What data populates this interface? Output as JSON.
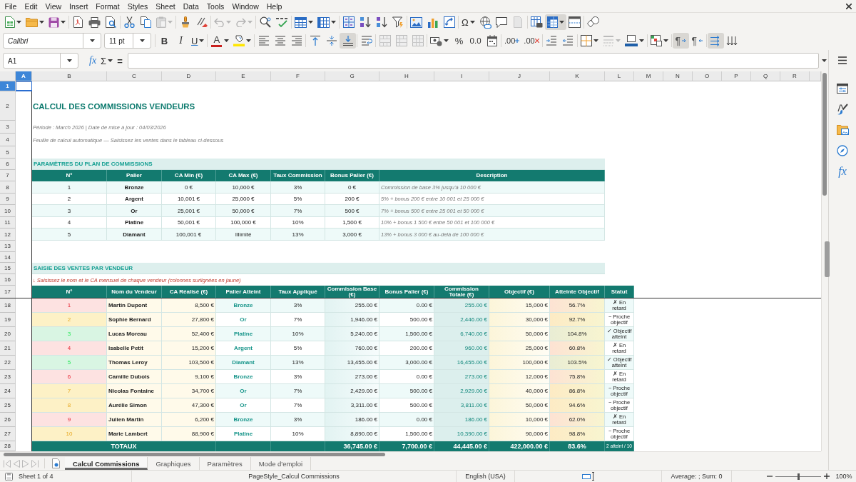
{
  "menu_bar": {
    "items": [
      "File",
      "Edit",
      "View",
      "Insert",
      "Format",
      "Styles",
      "Sheet",
      "Data",
      "Tools",
      "Window",
      "Help"
    ]
  },
  "standard_toolbar": {
    "special_character": "Ω",
    "freeze_rows_and_columns": {
      "pressed": true
    }
  },
  "formatting_toolbar": {
    "font_name": "Calibri",
    "font_size": "11 pt",
    "bold": "B",
    "italic": "I",
    "underline": "U",
    "font_color": "A",
    "align_bottom": {
      "pressed": true
    },
    "percent": "%",
    "number_format": "0.0",
    "add_decimal": ".00",
    "delete_decimal": ".00",
    "paragraph_left_to_right": {
      "glyph": "¶",
      "pressed": true
    },
    "paragraph_right_to_left": {
      "glyph": "¶",
      "pressed": false
    },
    "text_direction_left_to_right": {
      "pressed": true
    }
  },
  "formula_bar": {
    "name_box": "A1",
    "function_wizard": "fx",
    "sum": "Σ",
    "formula": "="
  },
  "sheet": {
    "column_headers": [
      {
        "label": "A",
        "selected": true
      },
      {
        "label": "B",
        "selected": false
      },
      {
        "label": "C",
        "selected": false
      },
      {
        "label": "D",
        "selected": false
      },
      {
        "label": "E",
        "selected": false
      },
      {
        "label": "F",
        "selected": false
      },
      {
        "label": "G",
        "selected": false
      },
      {
        "label": "H",
        "selected": false
      },
      {
        "label": "I",
        "selected": false
      },
      {
        "label": "J",
        "selected": false
      },
      {
        "label": "K",
        "selected": false
      },
      {
        "label": "L",
        "selected": false
      },
      {
        "label": "M",
        "selected": false
      },
      {
        "label": "N",
        "selected": false
      },
      {
        "label": "O",
        "selected": false
      },
      {
        "label": "P",
        "selected": false
      },
      {
        "label": "Q",
        "selected": false
      },
      {
        "label": "R",
        "selected": false
      }
    ],
    "row_headers": [
      {
        "label": "1",
        "selected": true
      },
      {
        "label": "2",
        "selected": false
      },
      {
        "label": "3",
        "selected": false
      },
      {
        "label": "4",
        "selected": false
      },
      {
        "label": "5",
        "selected": false
      },
      {
        "label": "6",
        "selected": false
      },
      {
        "label": "7",
        "selected": false
      },
      {
        "label": "8",
        "selected": false
      },
      {
        "label": "9",
        "selected": false
      },
      {
        "label": "10",
        "selected": false
      },
      {
        "label": "11",
        "selected": false
      },
      {
        "label": "12",
        "selected": false
      },
      {
        "label": "13",
        "selected": false
      },
      {
        "label": "14",
        "selected": false
      },
      {
        "label": "15",
        "selected": false
      },
      {
        "label": "16",
        "selected": false
      },
      {
        "label": "17",
        "selected": false
      },
      {
        "label": "18",
        "selected": false
      },
      {
        "label": "19",
        "selected": false
      },
      {
        "label": "20",
        "selected": false
      },
      {
        "label": "21",
        "selected": false
      },
      {
        "label": "22",
        "selected": false
      },
      {
        "label": "23",
        "selected": false
      },
      {
        "label": "24",
        "selected": false
      },
      {
        "label": "25",
        "selected": false
      },
      {
        "label": "26",
        "selected": false
      },
      {
        "label": "27",
        "selected": false
      },
      {
        "label": "28",
        "selected": false
      }
    ],
    "title": "CALCUL DES COMMISSIONS VENDEURS",
    "period": "Période : March 2026 | Date de mise à jour : 04/03/2026",
    "note": "Feuille de calcul automatique — Saisissez les ventes dans le tableau ci-dessous",
    "parameters": {
      "heading": "PARAMÈTRES DU PLAN DE COMMISSIONS",
      "columns": [
        "N°",
        "Palier",
        "CA Min (€)",
        "CA Max (€)",
        "Taux Commission",
        "Bonus Palier (€)",
        "Description"
      ],
      "rows": [
        {
          "number": "1",
          "tier": "Bronze",
          "ca_min": "0 €",
          "ca_max": "10,000 €",
          "rate": "3%",
          "bonus": "0 €",
          "description": "Commission de base 3% jusqu'à 10 000 €"
        },
        {
          "number": "2",
          "tier": "Argent",
          "ca_min": "10,001 €",
          "ca_max": "25,000 €",
          "rate": "5%",
          "bonus": "200 €",
          "description": "5% + bonus 200 € entre 10 001 et 25 000 €"
        },
        {
          "number": "3",
          "tier": "Or",
          "ca_min": "25,001 €",
          "ca_max": "50,000 €",
          "rate": "7%",
          "bonus": "500 €",
          "description": "7% + bonus 500 € entre 25 001 et 50 000 €"
        },
        {
          "number": "4",
          "tier": "Platine",
          "ca_min": "50,001 €",
          "ca_max": "100,000 €",
          "rate": "10%",
          "bonus": "1,500 €",
          "description": "10% + bonus 1 500 € entre 50 001 et 100 000 €"
        },
        {
          "number": "5",
          "tier": "Diamant",
          "ca_min": "100,001 €",
          "ca_max": "Illimité",
          "rate": "13%",
          "bonus": "3,000 €",
          "description": "13% + bonus 3 000 € au-delà de 100 000 €"
        }
      ]
    },
    "sales": {
      "heading": "SAISIE DES VENTES PAR VENDEUR",
      "instruction": "↓ Saisissez le nom et le CA mensuel de chaque vendeur (colonnes surlignées en jaune)",
      "columns": [
        "N°",
        "Nom du Vendeur",
        "CA Réalisé (€)",
        "Palier Atteint",
        "Taux Appliqué",
        "Commission Base (€)",
        "Bonus Palier (€)",
        "Commission Totale (€)",
        "Objectif (€)",
        "Atteinte Objectif",
        "Statut"
      ],
      "rows": [
        {
          "number": "1",
          "color": "#fde2e1",
          "seller": "Martin Dupont",
          "revenue": "8,500 €",
          "tier": "Bronze",
          "rate": "3%",
          "commission_base": "255.00 €",
          "bonus": "0.00 €",
          "commission_total": "255.00 €",
          "objective": "15,000 €",
          "attainment": "56.7%",
          "status": "✗ En retard"
        },
        {
          "number": "2",
          "color": "#fdf1c6",
          "seller": "Sophie Bernard",
          "revenue": "27,800 €",
          "tier": "Or",
          "rate": "7%",
          "commission_base": "1,946.00 €",
          "bonus": "500.00 €",
          "commission_total": "2,446.00 €",
          "objective": "30,000 €",
          "attainment": "92.7%",
          "status": "~ Proche objectif"
        },
        {
          "number": "3",
          "color": "#d9f5e3",
          "seller": "Lucas Moreau",
          "revenue": "52,400 €",
          "tier": "Platine",
          "rate": "10%",
          "commission_base": "5,240.00 €",
          "bonus": "1,500.00 €",
          "commission_total": "6,740.00 €",
          "objective": "50,000 €",
          "attainment": "104.8%",
          "status": "✓ Objectif atteint"
        },
        {
          "number": "4",
          "color": "#fde2e1",
          "seller": "Isabelle Petit",
          "revenue": "15,200 €",
          "tier": "Argent",
          "rate": "5%",
          "commission_base": "760.00 €",
          "bonus": "200.00 €",
          "commission_total": "960.00 €",
          "objective": "25,000 €",
          "attainment": "60.8%",
          "status": "✗ En retard"
        },
        {
          "number": "5",
          "color": "#d9f5e3",
          "seller": "Thomas Leroy",
          "revenue": "103,500 €",
          "tier": "Diamant",
          "rate": "13%",
          "commission_base": "13,455.00 €",
          "bonus": "3,000.00 €",
          "commission_total": "16,455.00 €",
          "objective": "100,000 €",
          "attainment": "103.5%",
          "status": "✓ Objectif atteint"
        },
        {
          "number": "6",
          "color": "#fde2e1",
          "seller": "Camille Dubois",
          "revenue": "9,100 €",
          "tier": "Bronze",
          "rate": "3%",
          "commission_base": "273.00 €",
          "bonus": "0.00 €",
          "commission_total": "273.00 €",
          "objective": "12,000 €",
          "attainment": "75.8%",
          "status": "✗ En retard"
        },
        {
          "number": "7",
          "color": "#fdf1c6",
          "seller": "Nicolas Fontaine",
          "revenue": "34,700 €",
          "tier": "Or",
          "rate": "7%",
          "commission_base": "2,429.00 €",
          "bonus": "500.00 €",
          "commission_total": "2,929.00 €",
          "objective": "40,000 €",
          "attainment": "86.8%",
          "status": "~ Proche objectif"
        },
        {
          "number": "8",
          "color": "#fdf1c6",
          "seller": "Aurélie Simon",
          "revenue": "47,300 €",
          "tier": "Or",
          "rate": "7%",
          "commission_base": "3,311.00 €",
          "bonus": "500.00 €",
          "commission_total": "3,811.00 €",
          "objective": "50,000 €",
          "attainment": "94.6%",
          "status": "~ Proche objectif"
        },
        {
          "number": "9",
          "color": "#fde2e1",
          "seller": "Julien Martin",
          "revenue": "6,200 €",
          "tier": "Bronze",
          "rate": "3%",
          "commission_base": "186.00 €",
          "bonus": "0.00 €",
          "commission_total": "186.00 €",
          "objective": "10,000 €",
          "attainment": "62.0%",
          "status": "✗ En retard"
        },
        {
          "number": "10",
          "color": "#fdf1c6",
          "seller": "Marie Lambert",
          "revenue": "88,900 €",
          "tier": "Platine",
          "rate": "10%",
          "commission_base": "8,890.00 €",
          "bonus": "1,500.00 €",
          "commission_total": "10,390.00 €",
          "objective": "90,000 €",
          "attainment": "98.8%",
          "status": "~ Proche objectif"
        }
      ],
      "totals": {
        "label": "TOTAUX",
        "commission_base": "36,745.00 €",
        "bonus": "7,700.00 €",
        "commission_total": "44,445.00 €",
        "objective": "422,000.00 €",
        "attainment": "83.6%",
        "status": "2 atteint / 10"
      }
    }
  },
  "sheet_tabs": [
    {
      "label": "Calcul Commissions",
      "selected": true
    },
    {
      "label": "Graphiques",
      "selected": false
    },
    {
      "label": "Paramètres",
      "selected": false
    },
    {
      "label": "Mode d'emploi",
      "selected": false
    }
  ],
  "sidebar": {
    "functions": "fx"
  },
  "status_bar": {
    "sheet": "Sheet 1 of 4",
    "page_style": "PageStyle_Calcul Commissions",
    "language": "English (USA)",
    "selection_summary": "Average: ; Sum: 0",
    "zoom_slider": {
      "level": 0.5
    },
    "zoom": "100%"
  }
}
